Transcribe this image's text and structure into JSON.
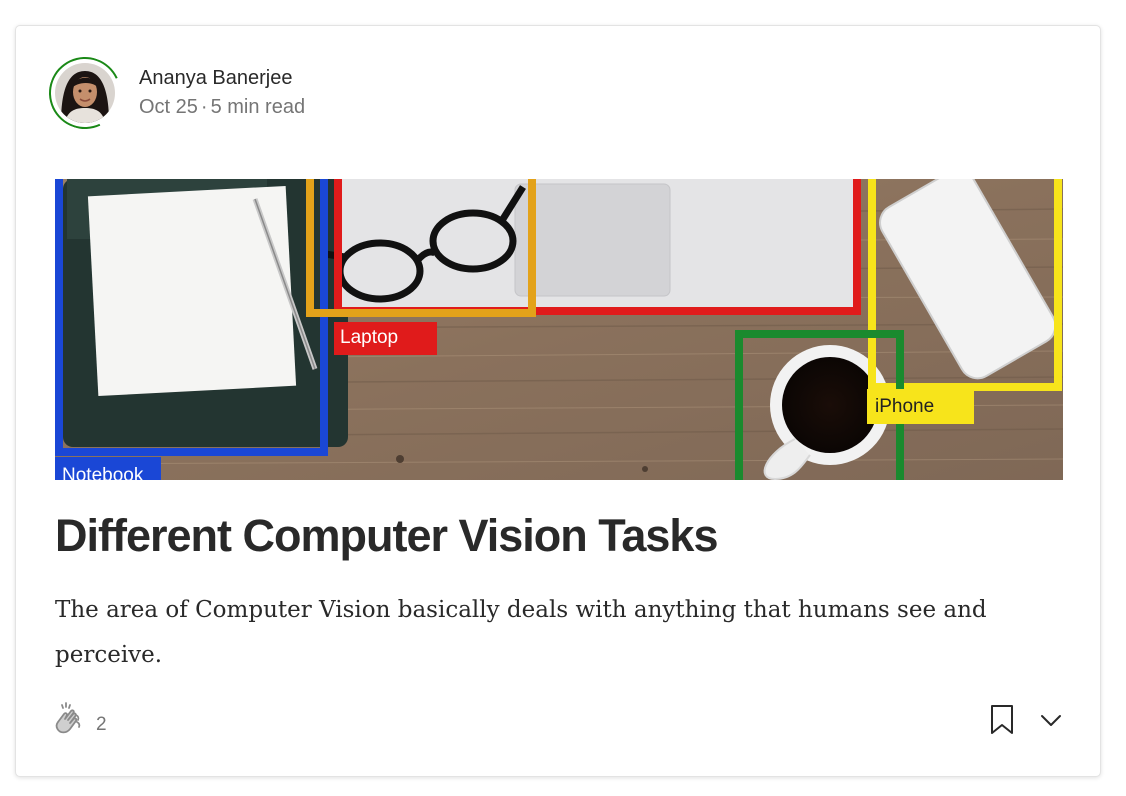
{
  "author": {
    "name": "Ananya Banerjee",
    "date": "Oct 25",
    "separator": "·",
    "read_time": "5 min read"
  },
  "image": {
    "labels": {
      "notebook": "Notebook",
      "laptop": "Laptop",
      "iphone": "iPhone"
    },
    "box_colors": {
      "notebook": "#1a47d6",
      "laptop": "#e01b1b",
      "glasses": "#e3a21a",
      "iphone": "#f7e41b",
      "cup": "#1a8a2e"
    }
  },
  "article": {
    "title": "Different Computer Vision Tasks",
    "subtitle": "The area of Computer Vision basically deals with anything that humans see and perceive."
  },
  "footer": {
    "clap_count": "2",
    "icons": [
      "clap-icon",
      "bookmark-icon",
      "chevron-down-icon"
    ]
  },
  "colors": {
    "accent_green": "#1a8917",
    "text_primary": "#292929",
    "text_secondary": "#757575"
  }
}
